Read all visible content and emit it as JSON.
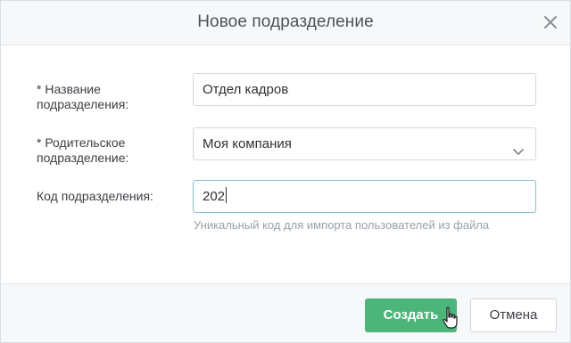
{
  "dialog": {
    "title": "Новое подразделение"
  },
  "form": {
    "name_label": "* Название подразделения:",
    "name_value": "Отдел кадров",
    "parent_label": "* Родительское подразделение:",
    "parent_value": "Моя компания",
    "code_label": "Код подразделения:",
    "code_value": "202",
    "code_hint": "Уникальный код для импорта пользователей из файла"
  },
  "footer": {
    "create_label": "Создать",
    "cancel_label": "Отмена"
  },
  "colors": {
    "primary": "#4cb57a",
    "focus_border": "#86c3cc"
  },
  "icons": {
    "close": "close-icon",
    "dropdown": "chevron-down-icon",
    "pointer": "hand-pointer-cursor"
  }
}
